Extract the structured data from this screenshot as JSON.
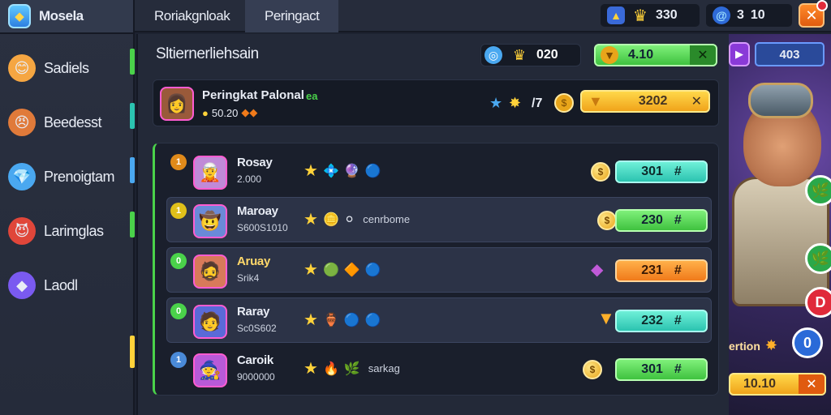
{
  "sidebar": {
    "header": {
      "label": "Mosela",
      "icon": "shield-icon"
    },
    "items": [
      {
        "label": "Sadiels",
        "icon": "hero-face-icon",
        "icon_bg": "#f5a642",
        "bar": "#4ad24a"
      },
      {
        "label": "Beedesst",
        "icon": "warrior-face-icon",
        "icon_bg": "#e07a3a",
        "bar": "#2bc3b0"
      },
      {
        "label": "Prenoigtam",
        "icon": "crystal-icon",
        "icon_bg": "#4aa8f0",
        "bar": "#4aa8f0"
      },
      {
        "label": "Larimglas",
        "icon": "demon-face-icon",
        "icon_bg": "#e0463a",
        "bar": "#4ad24a"
      },
      {
        "label": "Laodl",
        "icon": "gem-icon",
        "icon_bg": "#7a5af0",
        "bar": "#ffd23a"
      }
    ]
  },
  "tabs": [
    {
      "label": "Roriakgnloak",
      "active": false
    },
    {
      "label": "Peringact",
      "active": true
    }
  ],
  "resources": {
    "gold": {
      "value": "330",
      "icon": "crown-icon"
    },
    "energy": {
      "value": "3",
      "extra": "10",
      "icon": "swirl-icon"
    }
  },
  "close_label": "✕",
  "panel": {
    "title": "Sltiernerliehsain",
    "search_value": "020",
    "green_value": "4.10",
    "green_close": "✕",
    "play_label": "▶",
    "right_value": "403"
  },
  "featured": {
    "name": "Peringkat Palonal",
    "tag": "ea",
    "sub_value": "50.20",
    "rating_a": "/7",
    "gold_value": "3202",
    "gold_close": "✕"
  },
  "rows": [
    {
      "rank": "1",
      "rank_color": "#e08a1a",
      "name": "Rosay",
      "sub": "2.000",
      "avatar": "🧝",
      "avatar_bg": "#c08ad8",
      "note": "",
      "value": "301",
      "pill": "teal",
      "tail": "#",
      "icons": [
        "💠",
        "🔮",
        "🔵"
      ]
    },
    {
      "rank": "1",
      "rank_color": "#e0c01a",
      "name": "Maroay",
      "sub": "S600S1010",
      "avatar": "🤠",
      "avatar_bg": "#6a8ad8",
      "note": "cenrbome",
      "value": "230",
      "pill": "green",
      "tail": "#",
      "icons": [
        "🪙",
        "⚪"
      ]
    },
    {
      "rank": "0",
      "rank_color": "#4ad24a",
      "name": "Aruay",
      "sub": "Srik4",
      "avatar": "🧔",
      "avatar_bg": "#d87a5a",
      "note": "",
      "value": "231",
      "pill": "orange",
      "tail": "#",
      "icons": [
        "🟢",
        "🔶",
        "🔵"
      ]
    },
    {
      "rank": "0",
      "rank_color": "#4ad24a",
      "name": "Raray",
      "sub": "Sc0S602",
      "avatar": "🧑",
      "avatar_bg": "#5a6ad8",
      "note": "",
      "value": "232",
      "pill": "teal",
      "tail": "#",
      "icons": [
        "🏺",
        "🔵",
        "🔵"
      ]
    },
    {
      "rank": "1",
      "rank_color": "#4a8ad8",
      "name": "Caroik",
      "sub": "9000000",
      "avatar": "🧙",
      "avatar_bg": "#b85ad8",
      "note": "sarkag",
      "value": "301",
      "pill": "green",
      "tail": "#",
      "icons": [
        "🔥",
        "🌿"
      ]
    }
  ],
  "hero": {
    "caption": "ertion",
    "bottom_value": "10.10",
    "bottom_close": "✕",
    "buttons": [
      "🌿",
      "🌿",
      "D",
      "0"
    ]
  }
}
